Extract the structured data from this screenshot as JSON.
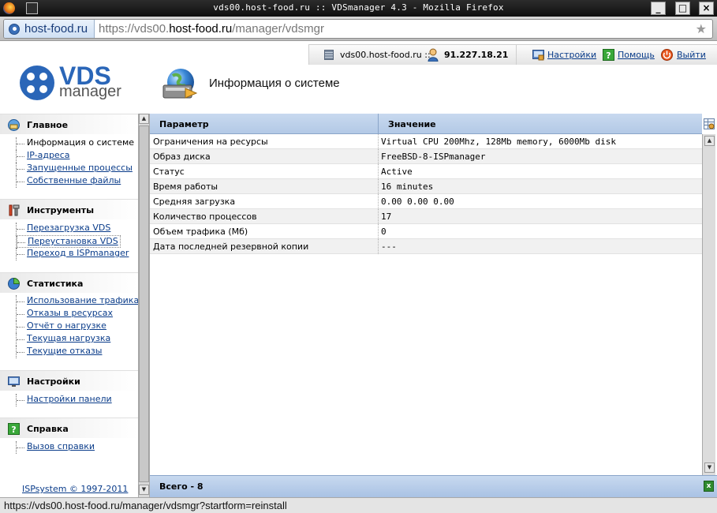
{
  "window": {
    "title": "vds00.host-food.ru :: VDSmanager 4.3 - Mozilla Firefox"
  },
  "browser": {
    "site_identity": "host-food.ru",
    "url_prefix": "https://vds00.",
    "url_domain": "host-food.ru",
    "url_path": "/manager/vdsmgr",
    "status_text": "https://vds00.host-food.ru/manager/vdsmgr?startform=reinstall"
  },
  "header": {
    "host": "vds00.host-food.ru ::",
    "ip": "91.227.18.21",
    "links": {
      "settings": "Настройки",
      "help": "Помощь",
      "logout": "Выйти"
    },
    "logo_top": "VDS",
    "logo_bottom": "manager",
    "page_title": "Информация о системе"
  },
  "sidebar": {
    "sections": [
      {
        "title": "Главное",
        "items": [
          "Информация о системе",
          "IP-адреса",
          "Запущенные процессы",
          "Собственные файлы"
        ]
      },
      {
        "title": "Инструменты",
        "items": [
          "Перезагрузка VDS",
          "Переустановка VDS",
          "Переход в ISPmanager"
        ]
      },
      {
        "title": "Статистика",
        "items": [
          "Использование трафика",
          "Отказы в ресурсах",
          "Отчёт о нагрузке",
          "Текущая нагрузка",
          "Текущие отказы"
        ]
      },
      {
        "title": "Настройки",
        "items": [
          "Настройки панели"
        ]
      },
      {
        "title": "Справка",
        "items": [
          "Вызов справки"
        ]
      }
    ],
    "copyright": "ISPsystem © 1997-2011"
  },
  "table": {
    "columns": [
      "Параметр",
      "Значение"
    ],
    "rows": [
      [
        "Ограничения на ресурсы",
        "Virtual CPU 200Mhz, 128Mb memory, 6000Mb disk"
      ],
      [
        "Образ диска",
        "FreeBSD-8-ISPmanager"
      ],
      [
        "Статус",
        "Active"
      ],
      [
        "Время работы",
        "16 minutes"
      ],
      [
        "Средняя загрузка",
        "0.00 0.00 0.00"
      ],
      [
        "Количество процессов",
        "17"
      ],
      [
        "Объем трафика (Мб)",
        "0"
      ],
      [
        "Дата последней резервной копии",
        "---"
      ]
    ],
    "footer_total": "Всего - 8"
  },
  "colors": {
    "accent": "#2a66b8",
    "table_header": "#b3c9e6",
    "link": "#0a3c8a"
  }
}
